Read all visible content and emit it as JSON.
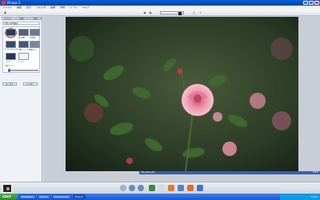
{
  "window": {
    "title": "Picasa 3",
    "controls": [
      "minimize",
      "maximize",
      "close"
    ]
  },
  "menu": {
    "items": [
      "ファイル",
      "編集",
      "表示",
      "フォルダ",
      "画像",
      "作成",
      "ツール",
      "ヘルプ"
    ]
  },
  "toolbar": {
    "back_label": "◀",
    "prev_label": "◀",
    "next_label": "▶",
    "zoom_thumb": "zoom-thumb"
  },
  "panel": {
    "tabs": [
      "基本修正",
      "調整",
      "効果"
    ],
    "subheader": "作業の自動検出",
    "effects": [
      {
        "label": "トリミング"
      },
      {
        "label": "傾き調整"
      },
      {
        "label": "赤目補正"
      },
      {
        "label": "I'm Feeling Lucky"
      },
      {
        "label": "自動コントラスト"
      },
      {
        "label": "自動カラー"
      },
      {
        "label": "レタッチ"
      },
      {
        "label": "テキスト"
      }
    ],
    "slider_label": "補正ライト",
    "undo_label": "元に戻す",
    "redo_label": "やり直し"
  },
  "viewer": {
    "filename": "IMG_0001.JPG",
    "zoom_text": "100%"
  },
  "filmbar": {
    "tools": [
      "star",
      "rotate-left",
      "rotate-right",
      "upload",
      "email",
      "print",
      "export",
      "blog",
      "collage"
    ]
  },
  "taskbar": {
    "start_label": "start",
    "tasks": [
      "RSS Reader",
      "Picasa 3",
      "Total Free Mon",
      "Picasa 3"
    ],
    "clock": "13:24"
  },
  "colors": {
    "titlebar": "#0a5fd8",
    "taskbar": "#1f55d4",
    "start": "#2f8a2c",
    "selection_ring": "#d93030",
    "rose": "#e88aa0"
  }
}
